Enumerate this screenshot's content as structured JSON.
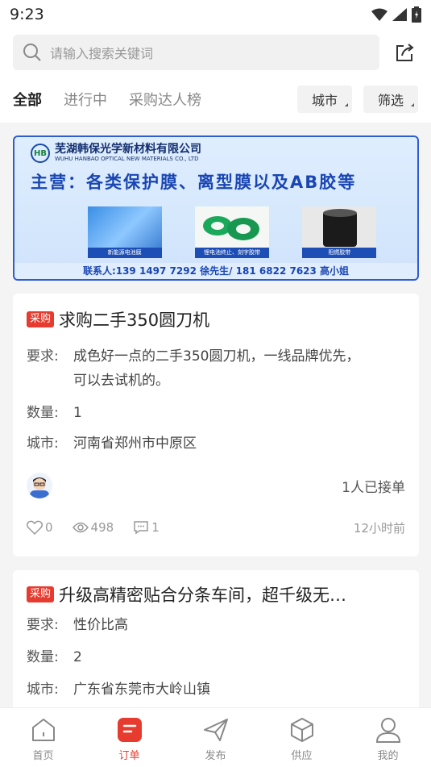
{
  "status_bar": {
    "time": "9:23"
  },
  "search": {
    "placeholder": "请输入搜索关键词"
  },
  "tabs": [
    {
      "label": "全部",
      "active": true
    },
    {
      "label": "进行中",
      "active": false
    },
    {
      "label": "采购达人榜",
      "active": false
    }
  ],
  "filters": {
    "city": "城市",
    "filter": "筛选"
  },
  "banner": {
    "company_cn": "芜湖韩保光学新材料有限公司",
    "company_en": "WUHU HANBAO OPTICAL NEW MATERIALS CO., LTD",
    "logo_text": "HB",
    "headline": "主营：各类保护膜、离型膜以及AB胶等",
    "products": [
      "新能源电池膜",
      "锂电池终止、刻字胶带",
      "阻燃胶带"
    ],
    "contact": "联系人:139 1497 7292 徐先生/ 181 6822 7623 高小姐"
  },
  "cards": [
    {
      "tag": "采购",
      "title": "求购二手350圆刀机",
      "requirement_label": "要求:",
      "requirement_line1": "成色好一点的二手350圆刀机，一线品牌优先，",
      "requirement_line2": "可以去试机的。",
      "quantity_label": "数量:",
      "quantity": "1",
      "city_label": "城市:",
      "city": "河南省郑州市中原区",
      "accepted": "1人已接单",
      "likes": "0",
      "views": "498",
      "comments": "1",
      "time_ago": "12小时前"
    },
    {
      "tag": "采购",
      "title": "升级高精密贴合分条车间，超千级无…",
      "requirement_label": "要求:",
      "requirement": "性价比高",
      "quantity_label": "数量:",
      "quantity": "2",
      "city_label": "城市:",
      "city": "广东省东莞市大岭山镇"
    }
  ],
  "bottom_nav": [
    {
      "label": "首页",
      "icon": "home-icon",
      "active": false
    },
    {
      "label": "订单",
      "icon": "order-icon",
      "active": true
    },
    {
      "label": "发布",
      "icon": "send-icon",
      "active": false
    },
    {
      "label": "供应",
      "icon": "box-icon",
      "active": false
    },
    {
      "label": "我的",
      "icon": "user-icon",
      "active": false
    }
  ],
  "colors": {
    "accent": "#e63b2e",
    "banner_blue": "#1a46b3"
  }
}
